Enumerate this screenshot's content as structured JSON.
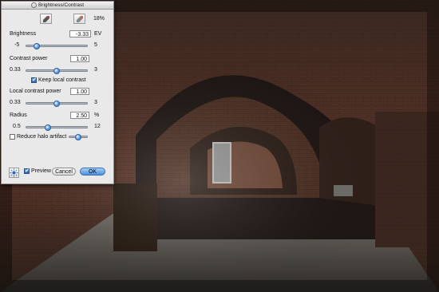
{
  "dialog": {
    "title": "Brightness/Contrast",
    "percent": "18%",
    "brightness": {
      "label": "Brightness",
      "value": "-3.33",
      "unit": "EV",
      "min": "-5",
      "max": "5",
      "slider_fraction": 0.167
    },
    "contrast_power": {
      "label": "Contrast power",
      "value": "1.00",
      "min": "0.33",
      "max": "3",
      "slider_fraction": 0.5
    },
    "keep_local_contrast": {
      "label": "Keep local contrast",
      "checked": true
    },
    "local_contrast_power": {
      "label": "Local contrast power",
      "value": "1.00",
      "min": "0.33",
      "max": "3",
      "slider_fraction": 0.5
    },
    "radius": {
      "label": "Radius",
      "value": "2.50",
      "unit": "%",
      "min": "0.5",
      "max": "12",
      "slider_fraction": 0.36
    },
    "reduce_halo": {
      "label": "Reduce halo artifact",
      "checked": false,
      "slider_fraction": 0.5
    },
    "preview": {
      "label": "Preview",
      "checked": true
    },
    "cancel_label": "Cancel",
    "ok_label": "OK",
    "check_mark": "✔"
  },
  "colors": {
    "accent": "#3a7bd5",
    "dialog_bg": "#e9e9e9",
    "brick": "#6b3a2c",
    "floor": "#5a5650"
  },
  "icons": [
    "eyedropper-dark-icon",
    "eyedropper-light-icon",
    "sun-icon"
  ]
}
